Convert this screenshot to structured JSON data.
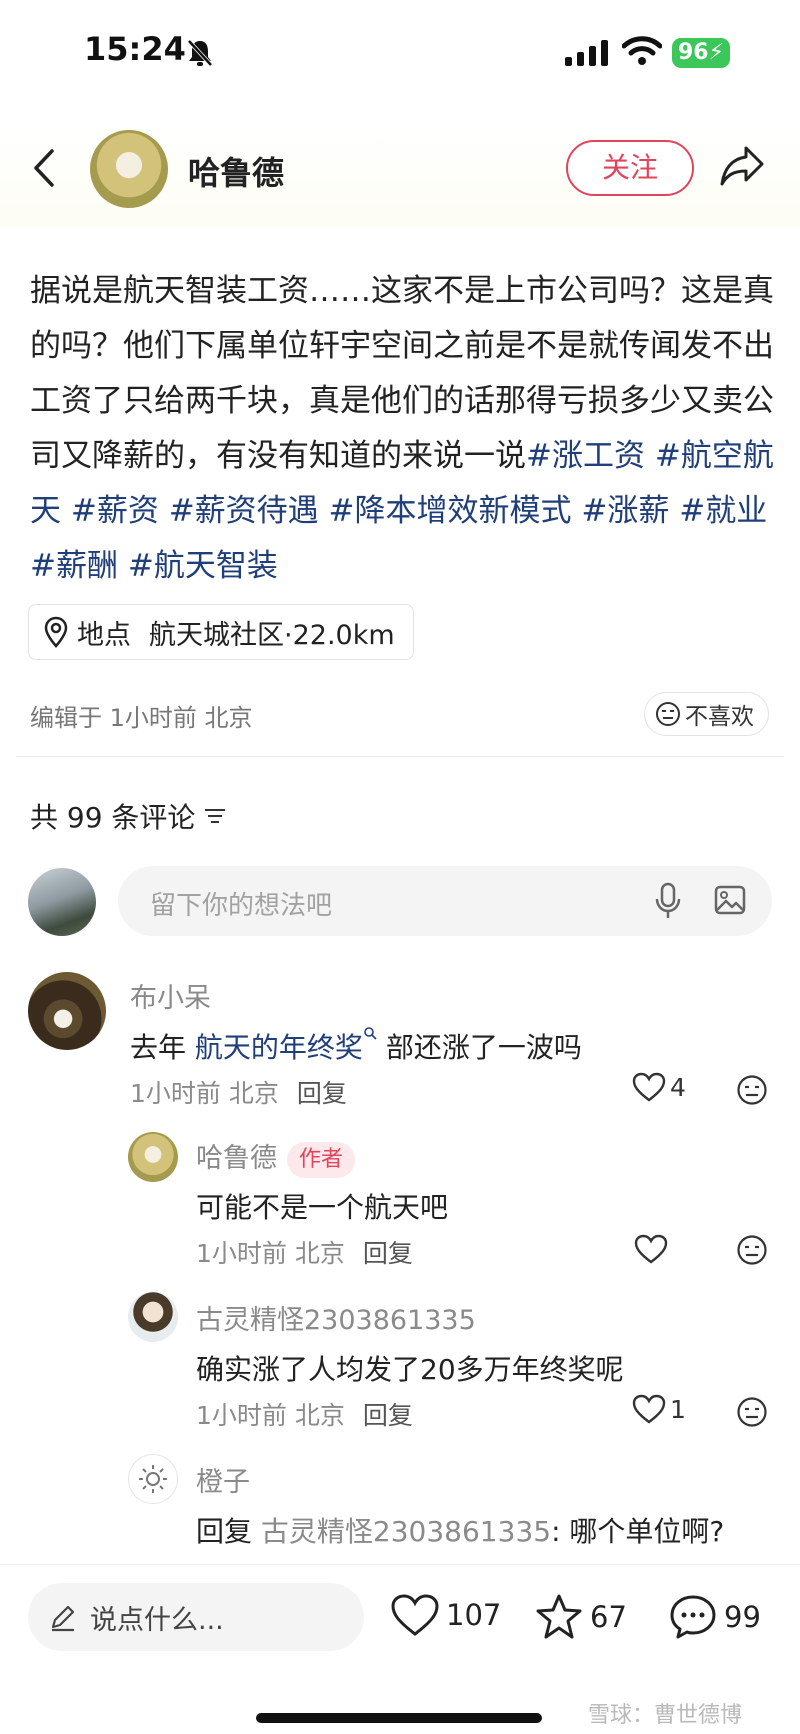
{
  "status_bar": {
    "time": "15:24",
    "battery": "96"
  },
  "header": {
    "author_name": "哈鲁德",
    "follow_label": "关注"
  },
  "post": {
    "text": "据说是航天智装工资……这家不是上市公司吗？这是真的吗？他们下属单位轩宇空间之前是不是就传闻发不出工资了只给两千块，真是他们的话那得亏损多少又卖公司又降薪的，有没有知道的来说一说",
    "tags": [
      "#涨工资",
      "#航空航天",
      "#薪资",
      "#薪资待遇",
      "#降本增效新模式",
      "#涨薪",
      "#就业",
      "#薪酬",
      "#航天智装"
    ],
    "location_label": "地点",
    "location_value": "航天城社区·22.0km",
    "edited": "编辑于 1小时前 北京",
    "dislike_label": "不喜欢"
  },
  "comments_section": {
    "count_label": "共 99 条评论",
    "input_placeholder": "留下你的想法吧"
  },
  "comments": [
    {
      "name": "布小呆",
      "prefix": "去年 ",
      "link": "航天的年终奖",
      "suffix": " 部还涨了一波吗",
      "time": "1小时前 北京",
      "reply": "回复",
      "likes": "4"
    },
    {
      "name": "哈鲁德",
      "badge": "作者",
      "text": "可能不是一个航天吧",
      "time": "1小时前 北京",
      "reply": "回复",
      "likes": ""
    },
    {
      "name": "古灵精怪2303861335",
      "text": "确实涨了人均发了20多万年终奖呢",
      "time": "1小时前 北京",
      "reply": "回复",
      "likes": "1"
    },
    {
      "name": "橙子",
      "reply_word": "回复",
      "reply_to": "古灵精怪2303861335",
      "text": ": 哪个单位啊?"
    }
  ],
  "bottom_bar": {
    "say_placeholder": "说点什么...",
    "likes": "107",
    "stars": "67",
    "comments": "99"
  },
  "watermark": "雪球：曹世德博"
}
